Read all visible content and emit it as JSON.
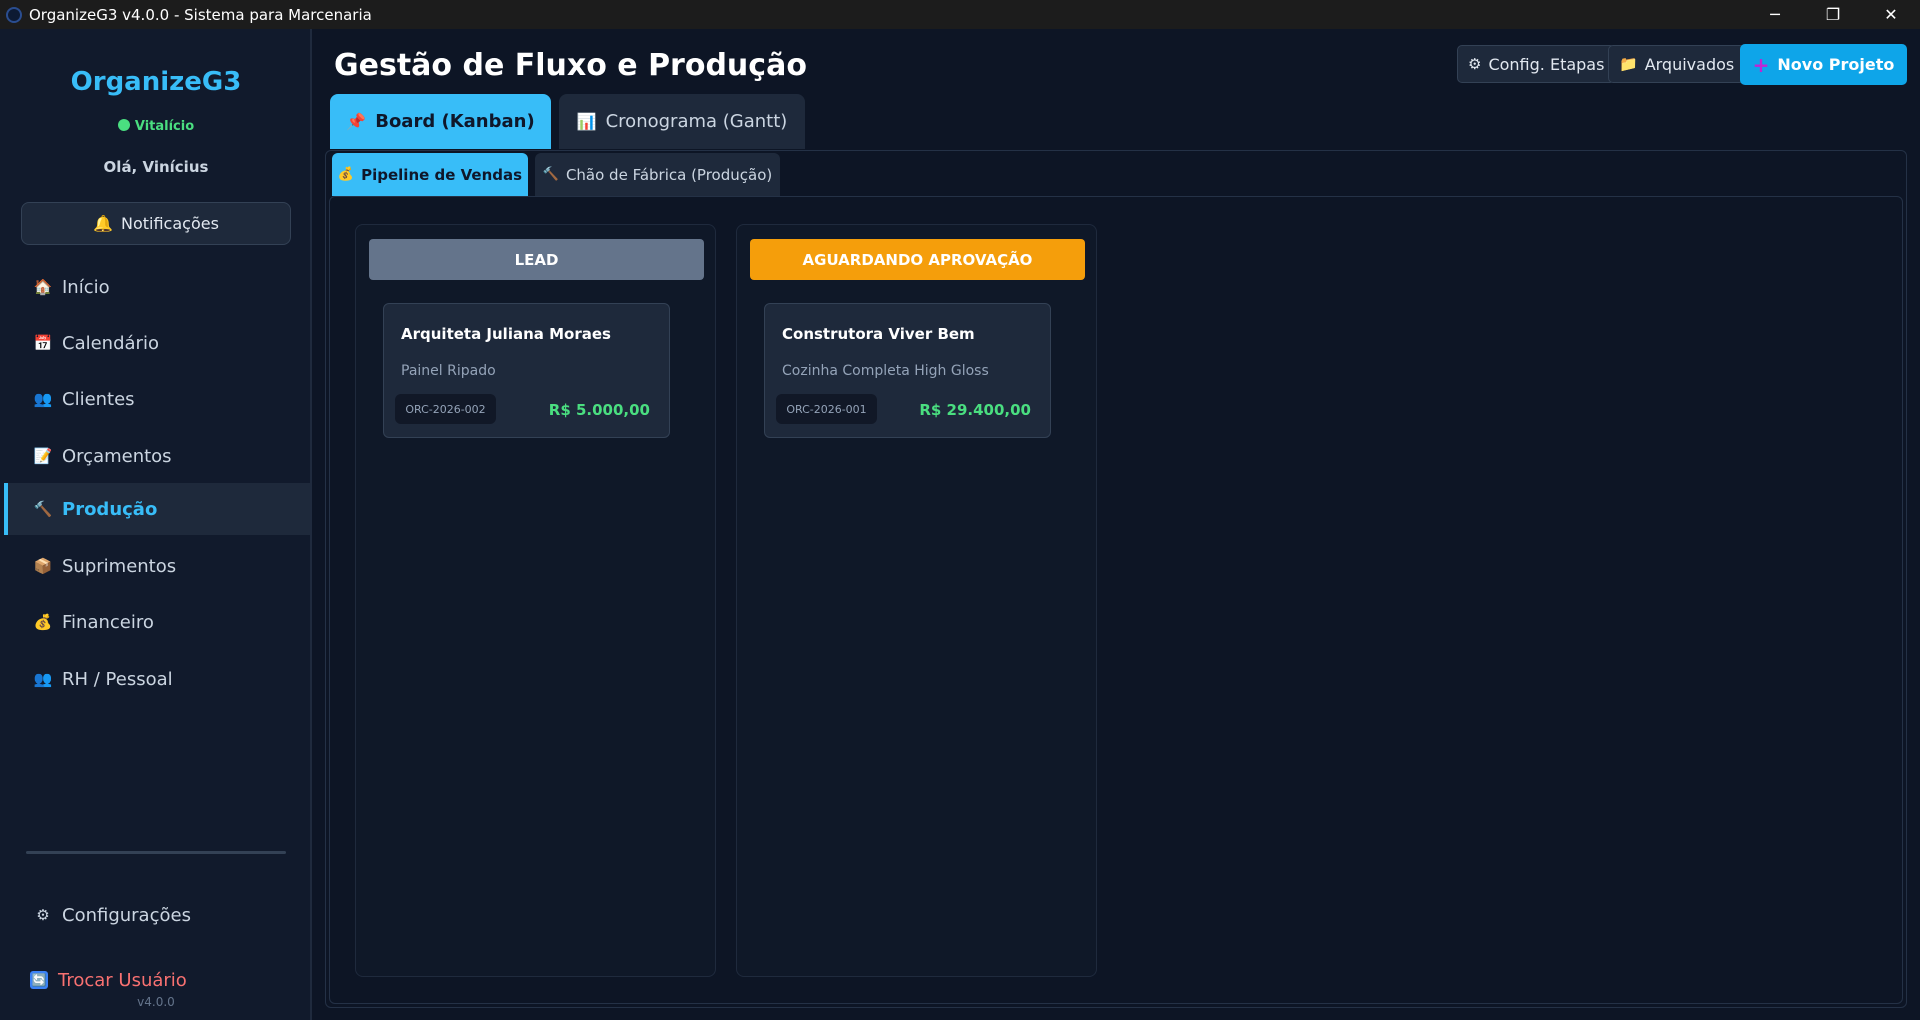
{
  "window": {
    "title": "OrganizeG3 v4.0.0 - Sistema para Marcenaria",
    "minimize_icon": "─",
    "maximize_icon": "❐",
    "close_icon": "✕"
  },
  "sidebar": {
    "brand": "OrganizeG3",
    "plan": "Vitalício",
    "greeting": "Olá, Vinícius",
    "notifications": {
      "icon": "🔔",
      "label": "Notificações"
    },
    "items": [
      {
        "icon": "🏠",
        "label": "Início",
        "active": false
      },
      {
        "icon": "📅",
        "label": "Calendário",
        "active": false
      },
      {
        "icon": "👥",
        "label": "Clientes",
        "active": false
      },
      {
        "icon": "📝",
        "label": "Orçamentos",
        "active": false
      },
      {
        "icon": "🔨",
        "label": "Produção",
        "active": true
      },
      {
        "icon": "📦",
        "label": "Suprimentos",
        "active": false
      },
      {
        "icon": "💰",
        "label": "Financeiro",
        "active": false
      },
      {
        "icon": "👥",
        "label": "RH / Pessoal",
        "active": false
      }
    ],
    "settings": {
      "icon": "⚙",
      "label": "Configurações"
    },
    "switch_user": {
      "icon": "🔄",
      "label": "Trocar Usuário"
    },
    "version": "v4.0.0"
  },
  "header": {
    "title": "Gestão de Fluxo e Produção",
    "config_stages": {
      "icon": "⚙",
      "label": "Config. Etapas"
    },
    "archived": {
      "icon": "📁",
      "label": "Arquivados"
    },
    "new_project": {
      "icon": "+",
      "label": "Novo Projeto"
    }
  },
  "tabs": {
    "kanban": {
      "icon": "📌",
      "label": "Board (Kanban)"
    },
    "gantt": {
      "icon": "📊",
      "label": "Cronograma (Gantt)"
    }
  },
  "subtabs": {
    "pipeline": {
      "icon": "💰",
      "label": "Pipeline de Vendas"
    },
    "fabrica": {
      "icon": "🔨",
      "label": "Chão de Fábrica (Produção)"
    }
  },
  "columns": [
    {
      "title": "LEAD",
      "color": "#64748b",
      "cards": [
        {
          "client": "Arquiteta Juliana Moraes",
          "project": "Painel Ripado",
          "code": "ORC-2026-002",
          "value": "R$ 5.000,00"
        }
      ]
    },
    {
      "title": "AGUARDANDO APROVAÇÃO",
      "color": "#f59e0b",
      "cards": [
        {
          "client": "Construtora Viver Bem",
          "project": "Cozinha Completa High Gloss",
          "code": "ORC-2026-001",
          "value": "R$ 29.400,00"
        }
      ]
    }
  ]
}
